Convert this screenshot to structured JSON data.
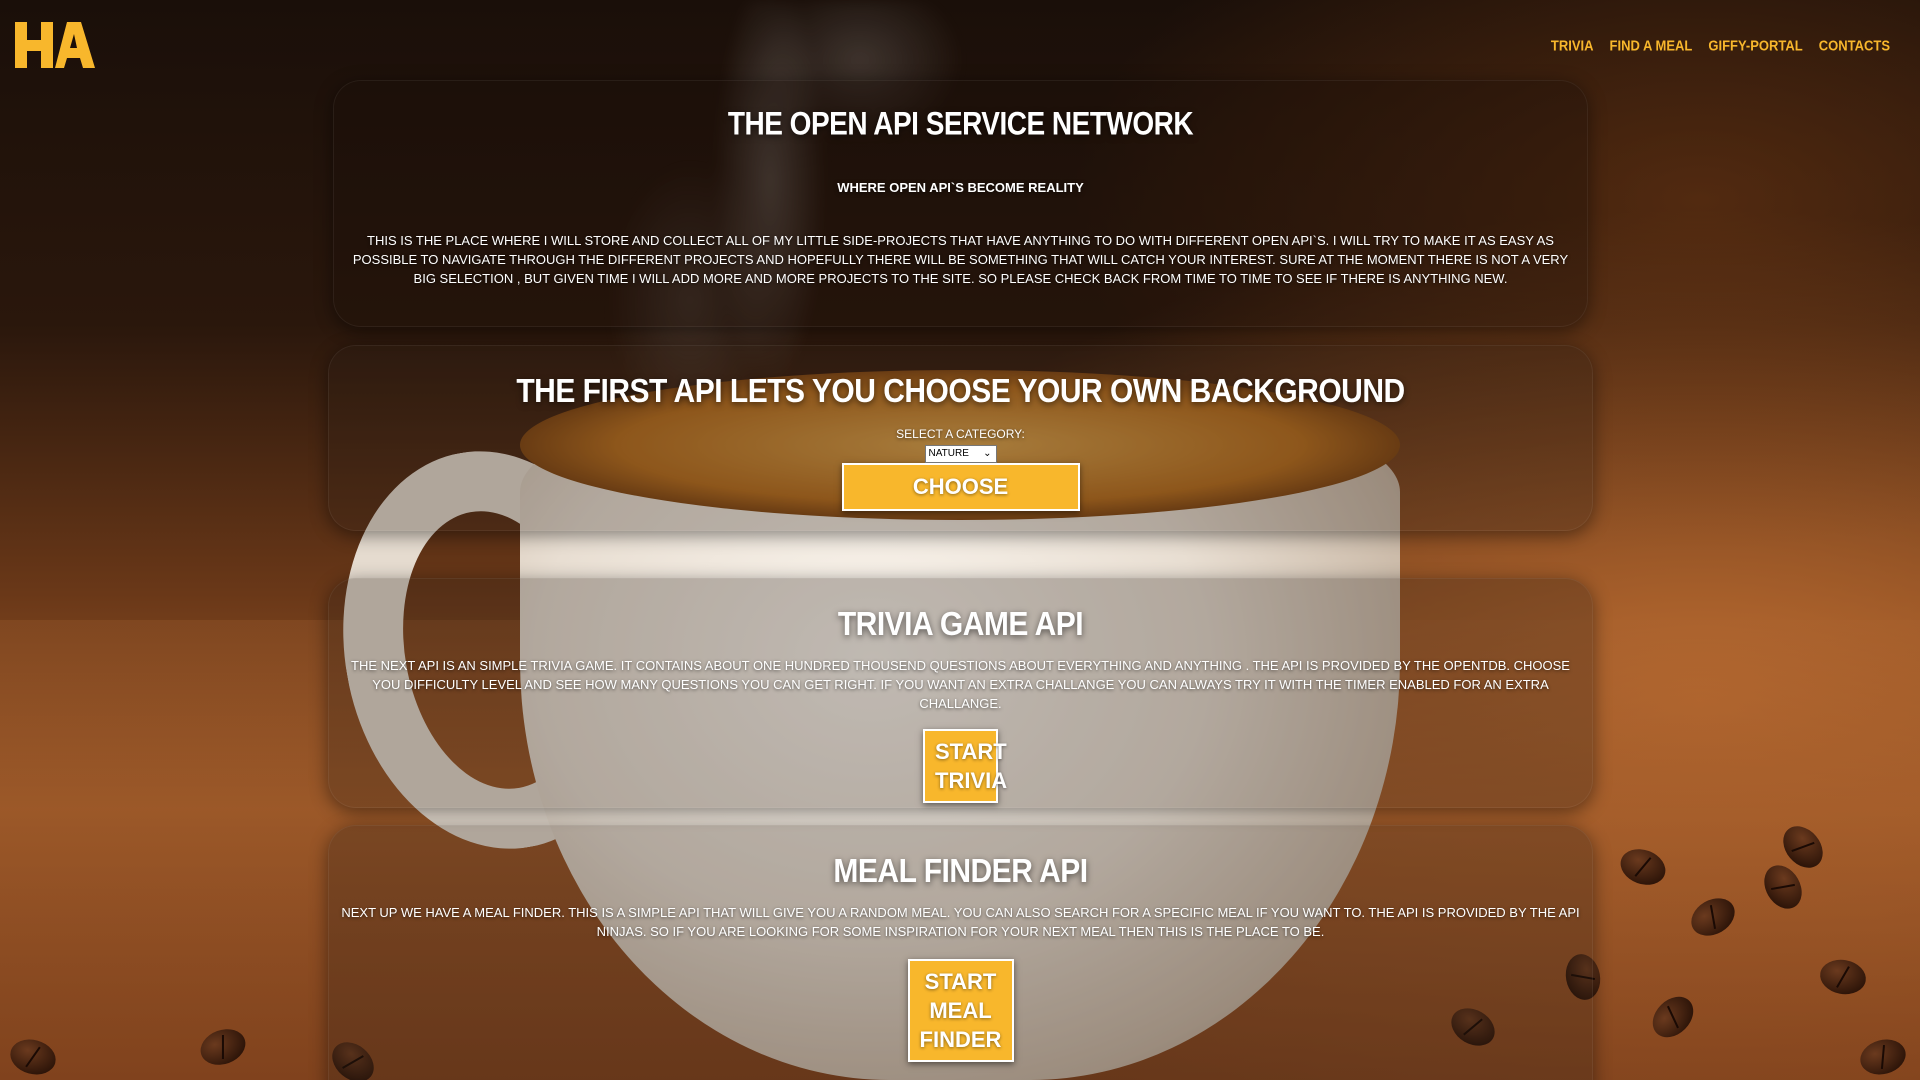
{
  "header": {
    "logo_text": "HA",
    "nav": [
      "Trivia",
      "Find a meal",
      "Giffy-portal",
      "Contacts"
    ]
  },
  "intro": {
    "title": "The Open API Service Network",
    "subtitle": "Where Open API`s become reality",
    "body": "This is the place where I will store and collect all of my little side-projects that have anything to do with different open API`s. I will try to make it as easy as possible to navigate through the different projects and hopefully there will be something that will catch your interest. Sure at the moment there is not a very big selection , but given time I will add more and more projects to the site. So please check back from time to time to see if there is anything new."
  },
  "background_api": {
    "title": "The first API lets you choose your own background",
    "category_label": "Select a category:",
    "selected_category": "Nature",
    "button": "Choose"
  },
  "trivia": {
    "title": "Trivia Game API",
    "body": "The next API is an simple trivia game. It contains about one hundred thousend questions about everything and anything . The API is provided by the OpenTDB. Choose you difficulty level and see how many questions you can get right. If you want an extra challange you can always try it with the timer enabled for an extra challange.",
    "button": "Start\nTrivia"
  },
  "meal": {
    "title": "Meal Finder API",
    "body": "Next up we have a meal finder. This is a simple API that will give you a random meal. You can also search for a specific meal if you want to. The API is provided by the API Ninjas. So if you are looking for some inspiration for your next meal then this is the place to be.",
    "button": "Start\nMeal\nFinder"
  },
  "colors": {
    "accent": "#f8b72c",
    "text": "#ffffff"
  }
}
